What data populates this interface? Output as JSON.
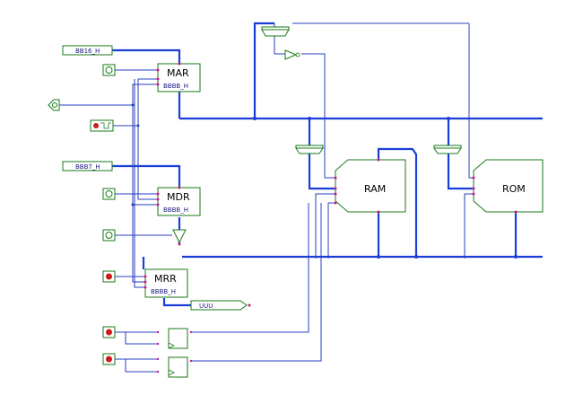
{
  "components": {
    "mar": {
      "label": "MAR",
      "out": "BBBB_H"
    },
    "mdr": {
      "label": "MDR",
      "out": "BBBB_H"
    },
    "mrr": {
      "label": "MRR",
      "out": "BBBB_H"
    },
    "ram": {
      "label": "RAM"
    },
    "rom": {
      "label": "ROM"
    }
  },
  "inputs": {
    "addr_value": "BB16_H",
    "data_value": "BBB7_H",
    "out_value": "UUU"
  }
}
